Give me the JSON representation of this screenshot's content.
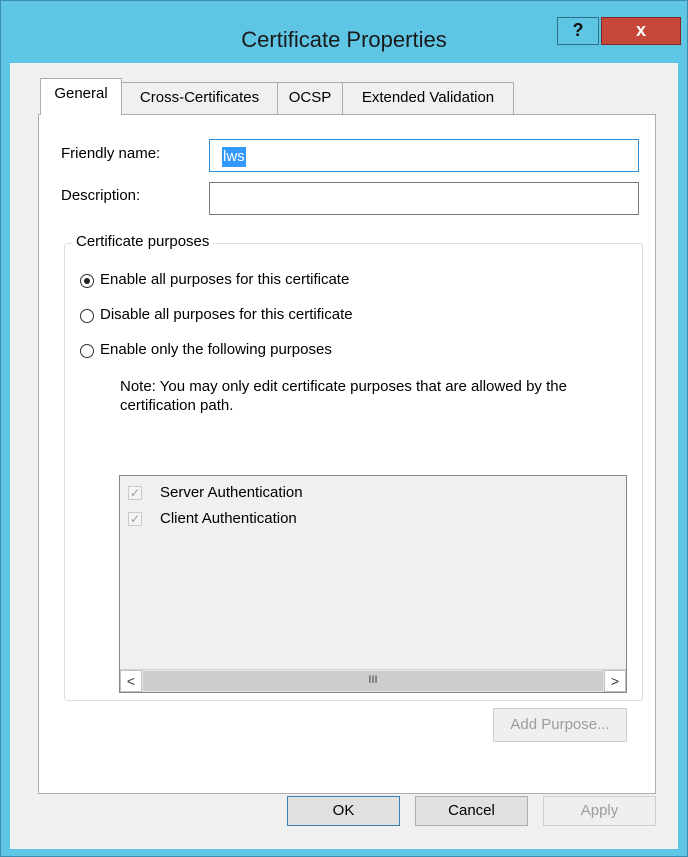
{
  "window": {
    "title": "Certificate Properties",
    "help_label": "?",
    "close_label": "x"
  },
  "tabs": [
    {
      "label": "General",
      "active": true
    },
    {
      "label": "Cross-Certificates",
      "active": false
    },
    {
      "label": "OCSP",
      "active": false
    },
    {
      "label": "Extended Validation",
      "active": false
    }
  ],
  "general": {
    "friendly_name_label": "Friendly name:",
    "friendly_name_value": "lws",
    "description_label": "Description:",
    "description_value": "",
    "purposes_group_title": "Certificate purposes",
    "radio_options": [
      {
        "label": "Enable all purposes for this certificate",
        "checked": true
      },
      {
        "label": "Disable all purposes for this certificate",
        "checked": false
      },
      {
        "label": "Enable only the following purposes",
        "checked": false
      }
    ],
    "note": "Note: You may only edit certificate purposes that are allowed by the certification path.",
    "purposes": [
      {
        "label": "Server Authentication",
        "checked": true
      },
      {
        "label": "Client Authentication",
        "checked": true
      }
    ],
    "scroll_left": "<",
    "scroll_right": ">",
    "scroll_thumb": "III",
    "add_purpose_label": "Add Purpose..."
  },
  "footer": {
    "ok_label": "OK",
    "cancel_label": "Cancel",
    "apply_label": "Apply"
  },
  "colors": {
    "title_bar": "#5fc5e4",
    "close_button": "#c7463a",
    "selection": "#3399ff"
  }
}
